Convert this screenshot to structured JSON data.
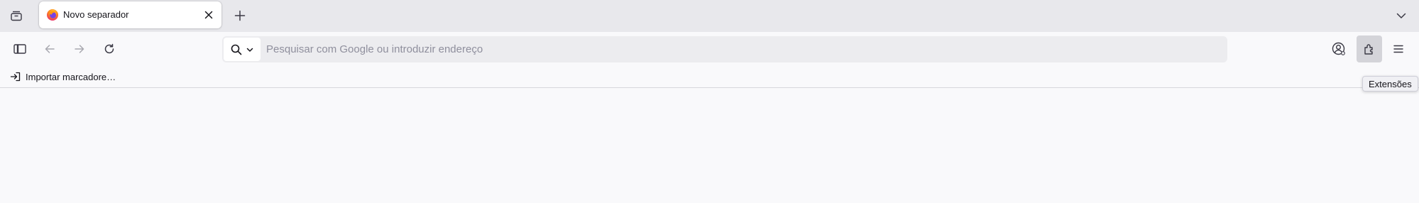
{
  "tabs": [
    {
      "title": "Novo separador",
      "favicon": "firefox-icon",
      "active": true
    }
  ],
  "tabstrip": {
    "tab_overview_icon": "tab-overview-icon",
    "close_icon": "close-icon",
    "new_tab_icon": "plus-icon",
    "list_all_tabs_icon": "chevron-down-icon"
  },
  "navbar": {
    "sidebar_icon": "sidebar-icon",
    "back_icon": "back-arrow-icon",
    "forward_icon": "forward-arrow-icon",
    "reload_icon": "reload-icon",
    "search_mode_icon": "search-icon",
    "url_placeholder": "Pesquisar com Google ou introduzir endereço",
    "url_value": "",
    "account_icon": "account-icon",
    "extensions_icon": "puzzle-icon",
    "menu_icon": "hamburger-menu-icon"
  },
  "bookmarks": {
    "items": [
      {
        "label": "Importar marcadore…",
        "icon": "import-icon"
      }
    ]
  },
  "tooltip": {
    "text": "Extensões"
  },
  "colors": {
    "tabstrip_bg": "#e8e8ec",
    "toolbar_bg": "#f9f9fb",
    "urlbar_bg": "#ececef",
    "active_button_bg": "#d4d4d9",
    "text": "#15141a",
    "placeholder": "#8f8f9d"
  }
}
